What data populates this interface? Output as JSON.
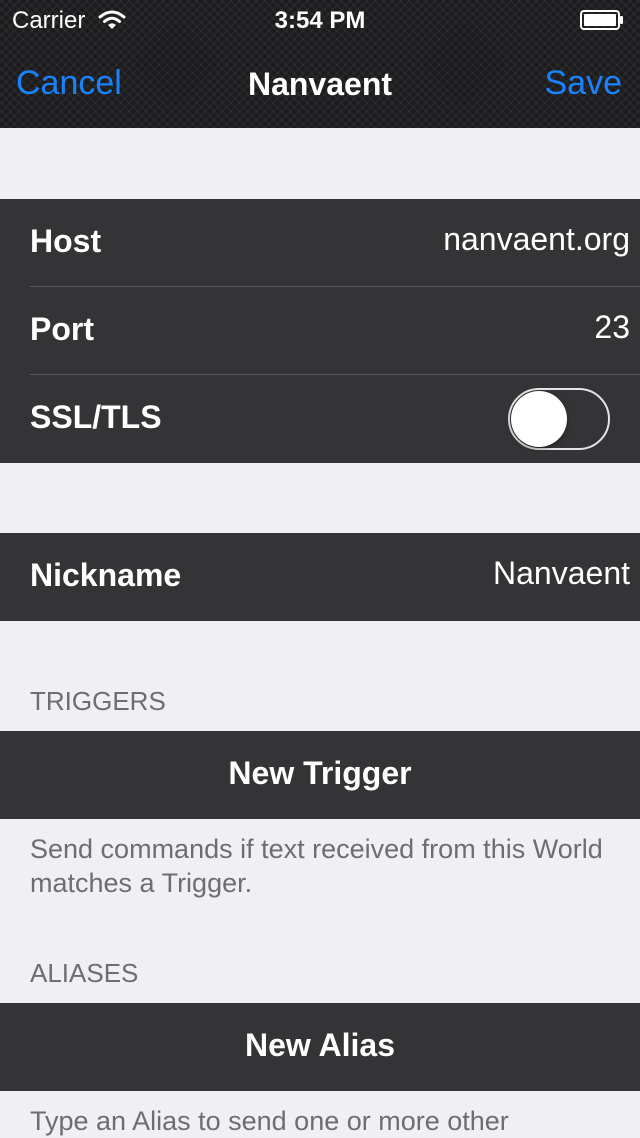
{
  "status_bar": {
    "carrier": "Carrier",
    "time": "3:54 PM"
  },
  "nav": {
    "cancel": "Cancel",
    "title": "Nanvaent",
    "save": "Save"
  },
  "connection": {
    "host": {
      "label": "Host",
      "value": "nanvaent.org"
    },
    "port": {
      "label": "Port",
      "value": "23"
    },
    "ssl": {
      "label": "SSL/TLS",
      "enabled": false
    }
  },
  "nickname": {
    "label": "Nickname",
    "value": "Nanvaent"
  },
  "triggers": {
    "header": "TRIGGERS",
    "button": "New Trigger",
    "footer": "Send commands if text received from this World matches a Trigger."
  },
  "aliases": {
    "header": "ALIASES",
    "button": "New Alias",
    "footer": "Type an Alias to send one or more other"
  },
  "colors": {
    "accent": "#1a82fb",
    "cell": "#343436",
    "background": "#efeff4"
  }
}
